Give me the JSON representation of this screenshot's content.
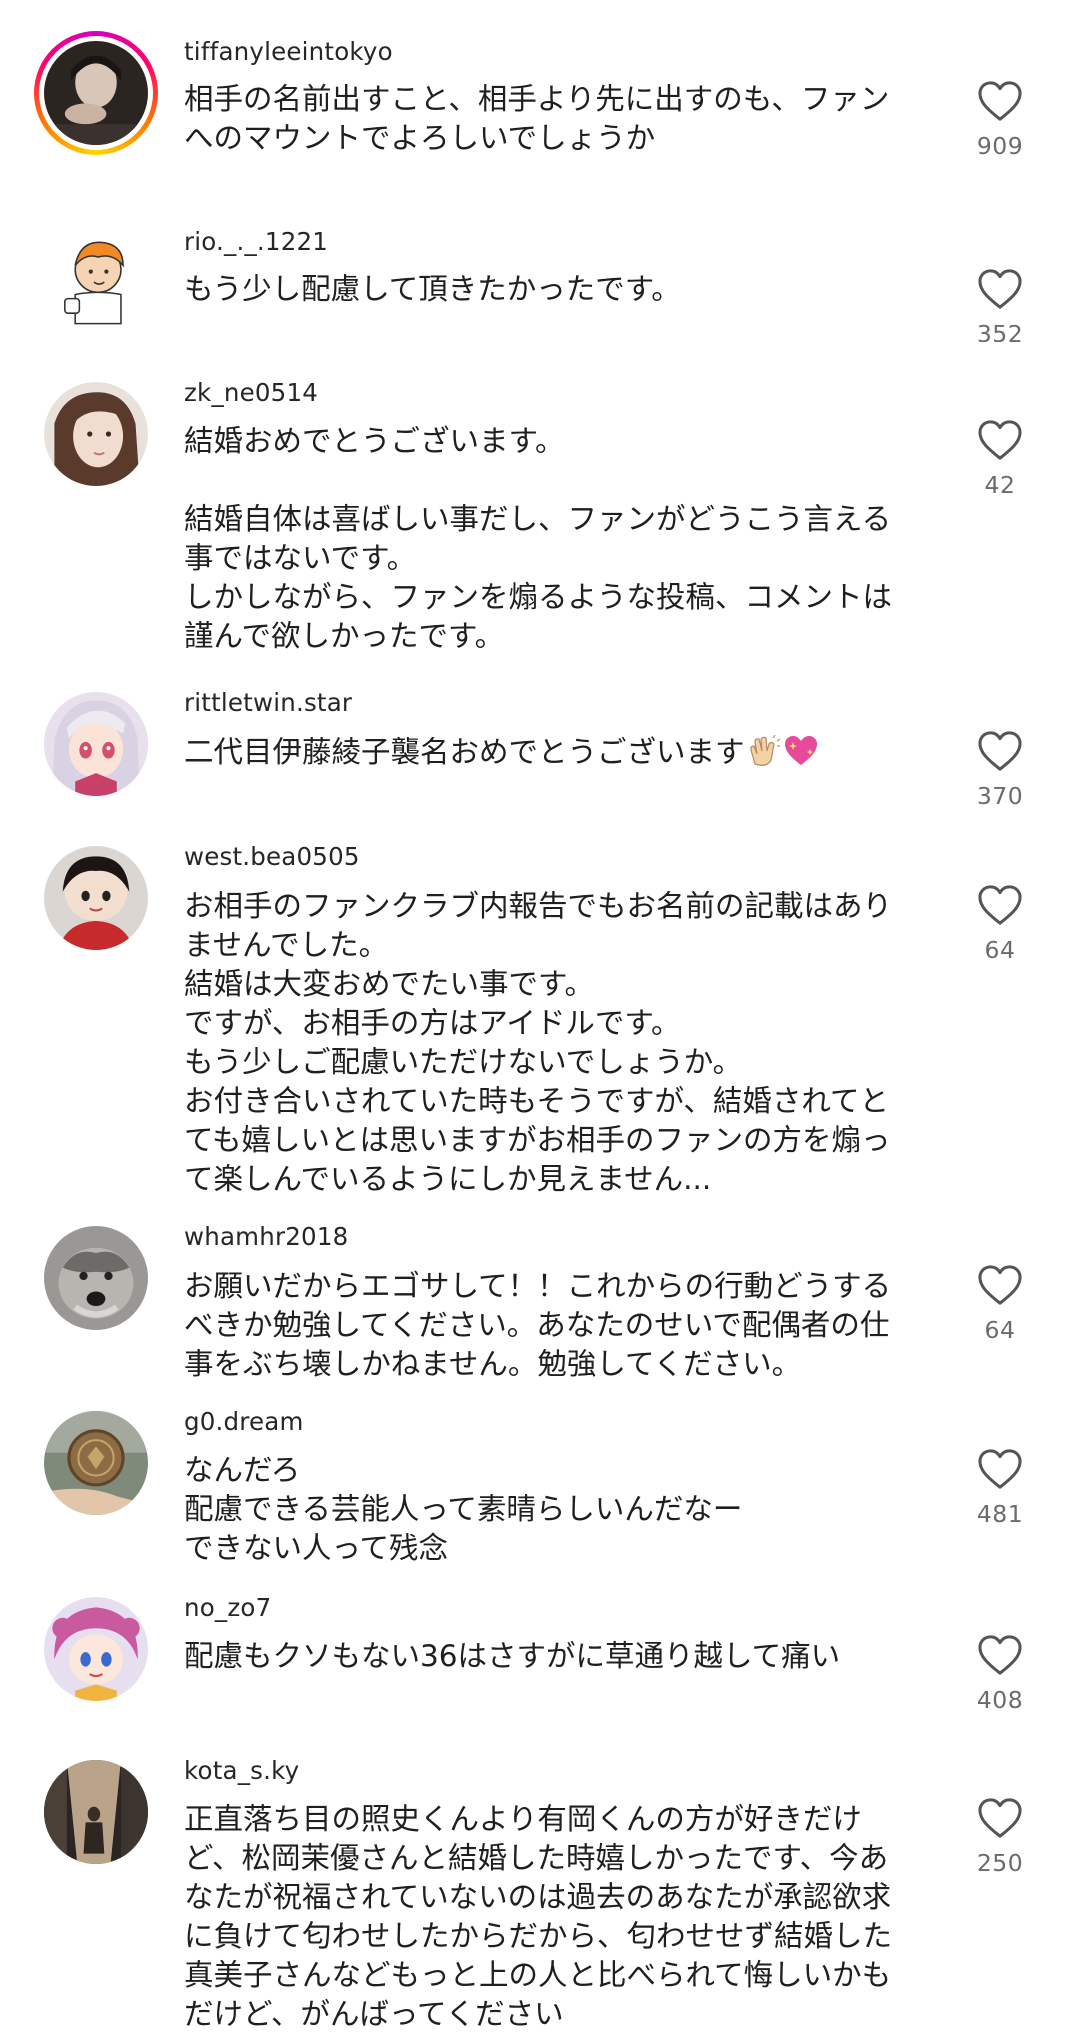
{
  "comments": [
    {
      "username": "tiffanyleeintokyo",
      "text": "相手の名前出すこと、相手より先に出すのも、ファン\nへのマウントでよろしいでしょうか",
      "likes": "909",
      "avatar_icon": "photo-avatar-story-ring"
    },
    {
      "username": "rio._._.1221",
      "text": "もう少し配慮して頂きたかったです。",
      "likes": "352",
      "avatar_icon": "cartoon-boy-avatar"
    },
    {
      "username": "zk_ne0514",
      "text": "結婚おめでとうございます。\n\n結婚自体は喜ばしい事だし、ファンがどうこう言える\n事ではないです。\nしかしながら、ファンを煽るような投稿、コメントは\n謹んで欲しかったです。",
      "likes": "42",
      "avatar_icon": "photo-avatar"
    },
    {
      "username": "rittletwin.star",
      "text": "二代目伊藤綾子襲名おめでとうございます",
      "emoji": [
        "clapping-hands-emoji",
        "sparkling-heart-emoji"
      ],
      "likes": "370",
      "avatar_icon": "anime-avatar"
    },
    {
      "username": "west.bea0505",
      "text": "お相手のファンクラブ内報告でもお名前の記載はあり\nませんでした。\n結婚は大変おめでたい事です。\nですが、お相手の方はアイドルです。\nもう少しご配慮いただけないでしょうか。\nお付き合いされていた時もそうですが、結婚されてと\nても嬉しいとは思いますがお相手のファンの方を煽っ\nて楽しんでいるようにしか見えません...",
      "likes": "64",
      "avatar_icon": "plush-doll-avatar"
    },
    {
      "username": "whamhr2018",
      "text": "お願いだからエゴサして！！これからの行動どうする\nべきか勉強してください。あなたのせいで配偶者の仕\n事をぶち壊しかねません。勉強してください。",
      "likes": "64",
      "avatar_icon": "dog-avatar"
    },
    {
      "username": "g0.dream",
      "text": "なんだろ\n配慮できる芸能人って素晴らしいんだなー\nできない人って残念",
      "likes": "481",
      "avatar_icon": "coin-avatar"
    },
    {
      "username": "no_zo7",
      "text": "配慮もクソもない36はさすがに草通り越して痛い",
      "likes": "408",
      "avatar_icon": "anime-girl-avatar"
    },
    {
      "username": "kota_s.ky",
      "text": "正直落ち目の照史くんより有岡くんの方が好きだけ\nど、松岡茉優さんと結婚した時嬉しかったです、今あ\nなたが祝福されていないのは過去のあなたが承認欲求\nに負けて匂わせしたからだから、匂わせせず結婚した\n真美子さんなどもっと上の人と比べられて悔しいかも\nだけど、がんばってください",
      "likes": "250",
      "avatar_icon": "street-photo-avatar"
    }
  ],
  "colors": {
    "background": "#ffffff",
    "text": "#1f1f1f",
    "like_count": "#6b6b6b",
    "heart_outline": "#555555"
  }
}
